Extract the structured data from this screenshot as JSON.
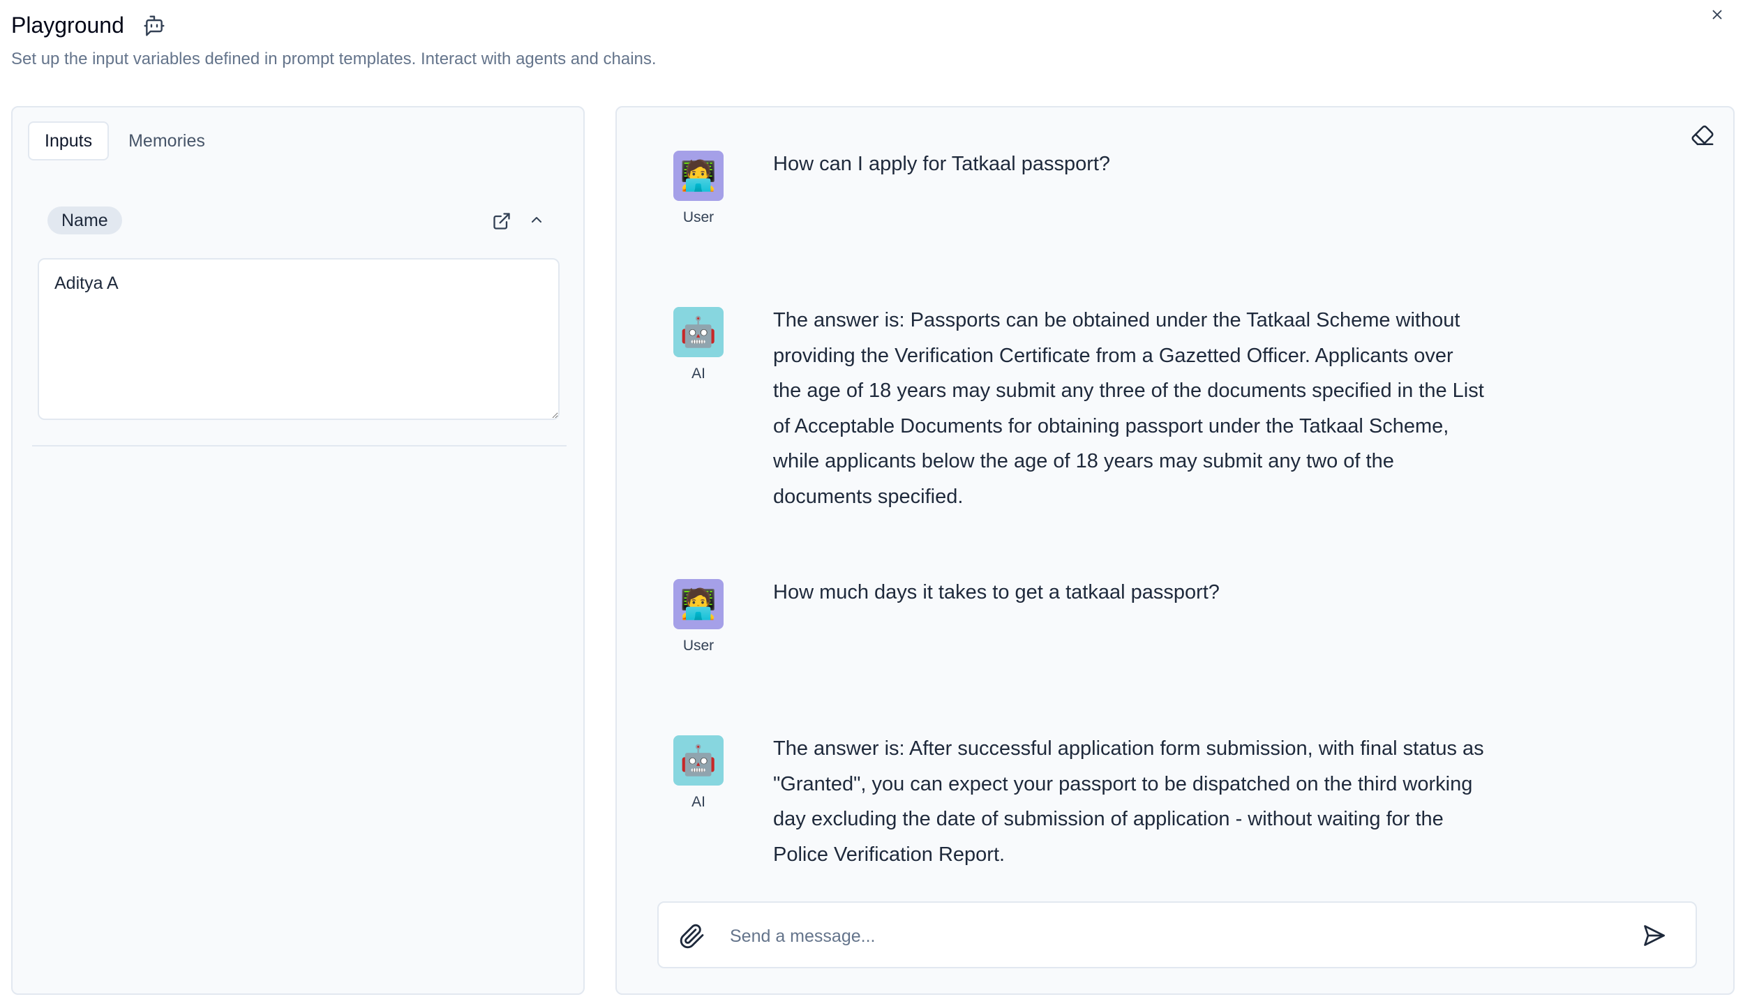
{
  "header": {
    "title": "Playground",
    "subtitle": "Set up the input variables defined in prompt templates. Interact with agents and chains."
  },
  "left_panel": {
    "tabs": [
      {
        "label": "Inputs",
        "active": true
      },
      {
        "label": "Memories",
        "active": false
      }
    ],
    "field": {
      "name": "Name",
      "value": "Aditya A"
    }
  },
  "chat": {
    "messages": [
      {
        "role": "User",
        "avatar": "🧑‍💻",
        "text": "How can I apply for Tatkaal passport?"
      },
      {
        "role": "AI",
        "avatar": "🤖",
        "text": "The answer is: Passports can be obtained under the Tatkaal Scheme without providing the Verification Certificate from a Gazetted Officer. Applicants over the age of 18 years may submit any three of the documents specified in the List of Acceptable Documents for obtaining passport under the Tatkaal Scheme, while applicants below the age of 18 years may submit any two of the documents specified."
      },
      {
        "role": "User",
        "avatar": "🧑‍💻",
        "text": "How much days it takes to get a tatkaal passport?"
      },
      {
        "role": "AI",
        "avatar": "🤖",
        "text": "The answer is: After successful application form submission, with final status as \"Granted\", you can expect your passport to be dispatched on the third working day excluding the date of submission of application - without waiting for the Police Verification Report."
      }
    ],
    "composer": {
      "placeholder": "Send a message..."
    }
  },
  "icons": {
    "title": "bot-message-icon",
    "close": "close-icon",
    "open_external": "external-link-icon",
    "collapse": "chevron-up-icon",
    "clear": "eraser-icon",
    "attach": "paperclip-icon",
    "send": "send-icon"
  },
  "colors": {
    "user_avatar_bg": "#a5a0e8",
    "ai_avatar_bg": "#87d6df",
    "panel_bg": "#f8fafc",
    "border": "#e2e8f0"
  }
}
